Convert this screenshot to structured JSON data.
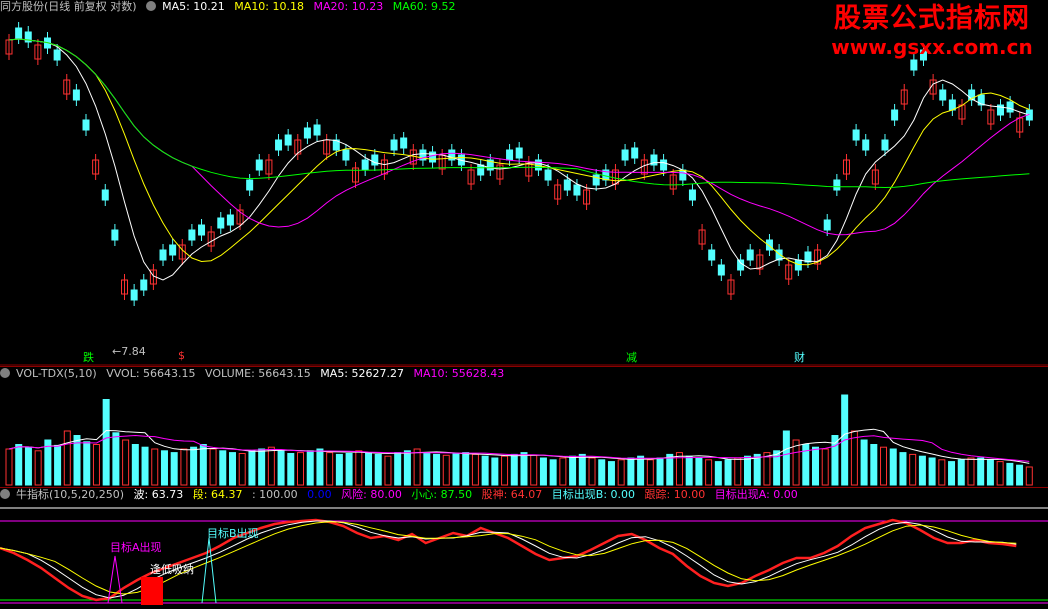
{
  "price_panel": {
    "stock_label": "同方股份(日线 前复权 对数)",
    "ma5": "MA5: 10.21",
    "ma10": "MA10: 10.18",
    "ma20": "MA20: 10.23",
    "ma60": "MA60: 9.52",
    "low_marker": "←7.84",
    "signals": [
      "跌",
      "$",
      "减",
      "财"
    ]
  },
  "volume_panel": {
    "name": "VOL-TDX(5,10)",
    "vvol": "VVOL: 56643.15",
    "volume": "VOLUME: 56643.15",
    "ma5": "MA5: 52627.27",
    "ma10": "MA10: 55628.43"
  },
  "indicator_panel": {
    "name": "牛指标(10,5,20,250)",
    "bo": "波: 63.73",
    "duan": "段: 64.37",
    "v100": ": 100.00",
    "v0": "0.00",
    "risk": "风险: 80.00",
    "careful": "小心: 87.50",
    "stock_god": "股神: 64.07",
    "target_b": "目标出现B: 0.00",
    "track": "跟踪: 10.00",
    "target_a": "目标出现A: 0.00",
    "label_a": "目标A出现",
    "label_b": "目标B出现",
    "label_buy": "逢低吸纳"
  },
  "watermark": {
    "title": "股票公式指标网",
    "url": "www.gsxx.com.cn"
  },
  "colors": {
    "up": "#ff3232",
    "down": "#54ffff",
    "ma5": "#ffffff",
    "ma10": "#ffff00",
    "ma20": "#ff00ff",
    "ma60": "#00ff00"
  }
}
